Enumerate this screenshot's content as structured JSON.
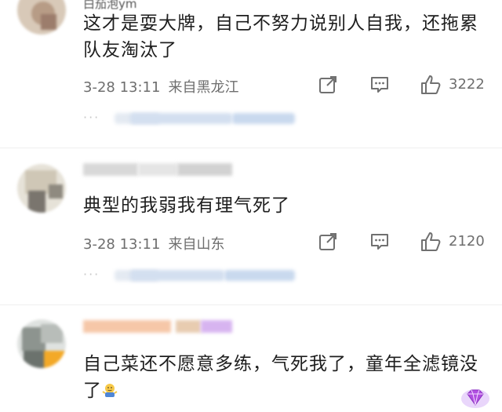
{
  "comments": [
    {
      "username": "白茄泡ym",
      "text": "这才是耍大牌，自己不努力说别人自我，还拖累队友淘汰了",
      "date": "3-28 13:11",
      "location": "来自黑龙江",
      "likes": "3222",
      "reply_dots": "···"
    },
    {
      "username": "",
      "text": "典型的我弱我有理气死了",
      "date": "3-28 13:11",
      "location": "来自山东",
      "likes": "2120",
      "reply_dots": "···"
    },
    {
      "username": "",
      "text": "自己菜还不愿意多练，气死我了，童年全滤镜没了",
      "date": "",
      "location": "",
      "likes": "",
      "reply_dots": ""
    }
  ],
  "icons": {
    "share": "share-icon",
    "comment": "comment-icon",
    "like": "thumbs-up-icon",
    "emoji": "shrug-emoji-icon",
    "badge": "diamond-badge-icon"
  },
  "colors": {
    "meta_text": "#6e6e6e",
    "body_text": "#1e1e1e",
    "badge": "#b04ee0"
  }
}
